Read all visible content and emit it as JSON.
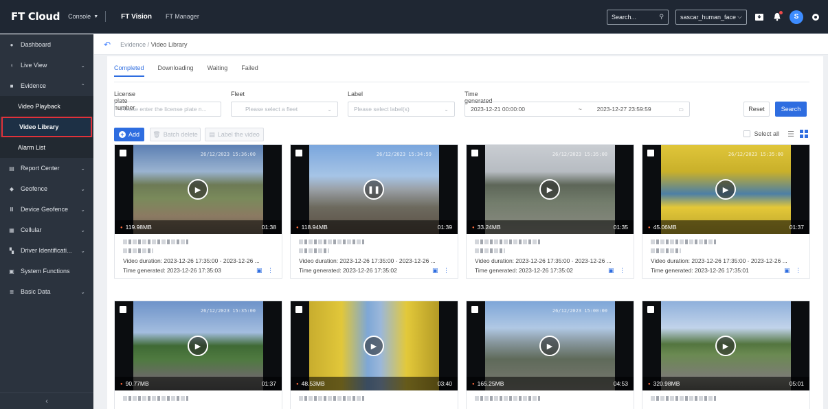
{
  "header": {
    "logo": "FT Cloud",
    "console": "Console",
    "nav": [
      "FT Vision",
      "FT Manager"
    ],
    "search_placeholder": "Search...",
    "account": "sascar_human_face",
    "avatar_letter": "S"
  },
  "sidebar": {
    "items": [
      {
        "label": "Dashboard",
        "icon": "dashboard-icon"
      },
      {
        "label": "Live View",
        "icon": "live-view-icon"
      },
      {
        "label": "Evidence",
        "icon": "evidence-icon"
      },
      {
        "label": "Report Center",
        "icon": "report-icon"
      },
      {
        "label": "Geofence",
        "icon": "geofence-icon"
      },
      {
        "label": "Device Geofence",
        "icon": "device-geofence-icon"
      },
      {
        "label": "Cellular",
        "icon": "cellular-icon"
      },
      {
        "label": "Driver Identificati...",
        "icon": "driver-id-icon"
      },
      {
        "label": "System Functions",
        "icon": "system-icon"
      },
      {
        "label": "Basic Data",
        "icon": "basic-data-icon"
      }
    ],
    "sub_items": [
      "Video Playback",
      "Video Library",
      "Alarm List"
    ],
    "active_sub": "Video Library"
  },
  "breadcrumb": {
    "parent": "Evidence",
    "current": "Video Library"
  },
  "tabs": [
    "Completed",
    "Downloading",
    "Waiting",
    "Failed"
  ],
  "filters": {
    "plate_label": "License plate number",
    "plate_placeholder": "Please enter the license plate n...",
    "fleet_label": "Fleet",
    "fleet_placeholder": "Please select a fleet",
    "label_label": "Label",
    "label_placeholder": "Please select label(s)",
    "time_label": "Time generated",
    "time_start": "2023-12-21 00:00:00",
    "time_sep": "~",
    "time_end": "2023-12-27 23:59:59",
    "reset": "Reset",
    "search": "Search"
  },
  "toolbar": {
    "add": "Add",
    "batch_delete": "Batch delete",
    "label_video": "Label the video",
    "select_all": "Select all"
  },
  "cards": [
    {
      "size": "119.98MB",
      "duration": "01:38",
      "stamp": "26/12/2023 15:36:00",
      "video_duration": "Video duration:  2023-12-26 17:35:00 - 2023-12-26 ...",
      "time_generated": "Time generated:  2023-12-26 17:35:03",
      "paused": false
    },
    {
      "size": "118.94MB",
      "duration": "01:39",
      "stamp": "26/12/2023 15:34:59",
      "video_duration": "Video duration:  2023-12-26 17:35:00 - 2023-12-26 ...",
      "time_generated": "Time generated:  2023-12-26 17:35:02",
      "paused": true
    },
    {
      "size": "33.24MB",
      "duration": "01:35",
      "stamp": "26/12/2023 15:35:00",
      "video_duration": "Video duration:  2023-12-26 17:35:00 - 2023-12-26 ...",
      "time_generated": "Time generated:  2023-12-26 17:35:02",
      "paused": false
    },
    {
      "size": "45.06MB",
      "duration": "01:37",
      "stamp": "26/12/2023 15:35:00",
      "video_duration": "Video duration:  2023-12-26 17:35:00 - 2023-12-26 ...",
      "time_generated": "Time generated:  2023-12-26 17:35:01",
      "paused": false
    },
    {
      "size": "90.77MB",
      "duration": "01:37",
      "stamp": "26/12/2023 15:35:00",
      "video_duration": "",
      "time_generated": "",
      "paused": false
    },
    {
      "size": "48.53MB",
      "duration": "03:40",
      "stamp": "",
      "video_duration": "",
      "time_generated": "",
      "paused": false
    },
    {
      "size": "165.25MB",
      "duration": "04:53",
      "stamp": "26/12/2023 15:00:00",
      "video_duration": "",
      "time_generated": "",
      "paused": false
    },
    {
      "size": "320.98MB",
      "duration": "05:01",
      "stamp": "",
      "video_duration": "",
      "time_generated": "",
      "paused": false
    }
  ],
  "colors": {
    "accent": "#2e6de0",
    "topbar": "#1f2733",
    "sidebar": "#2b333e",
    "active_outline": "#e0323a"
  }
}
